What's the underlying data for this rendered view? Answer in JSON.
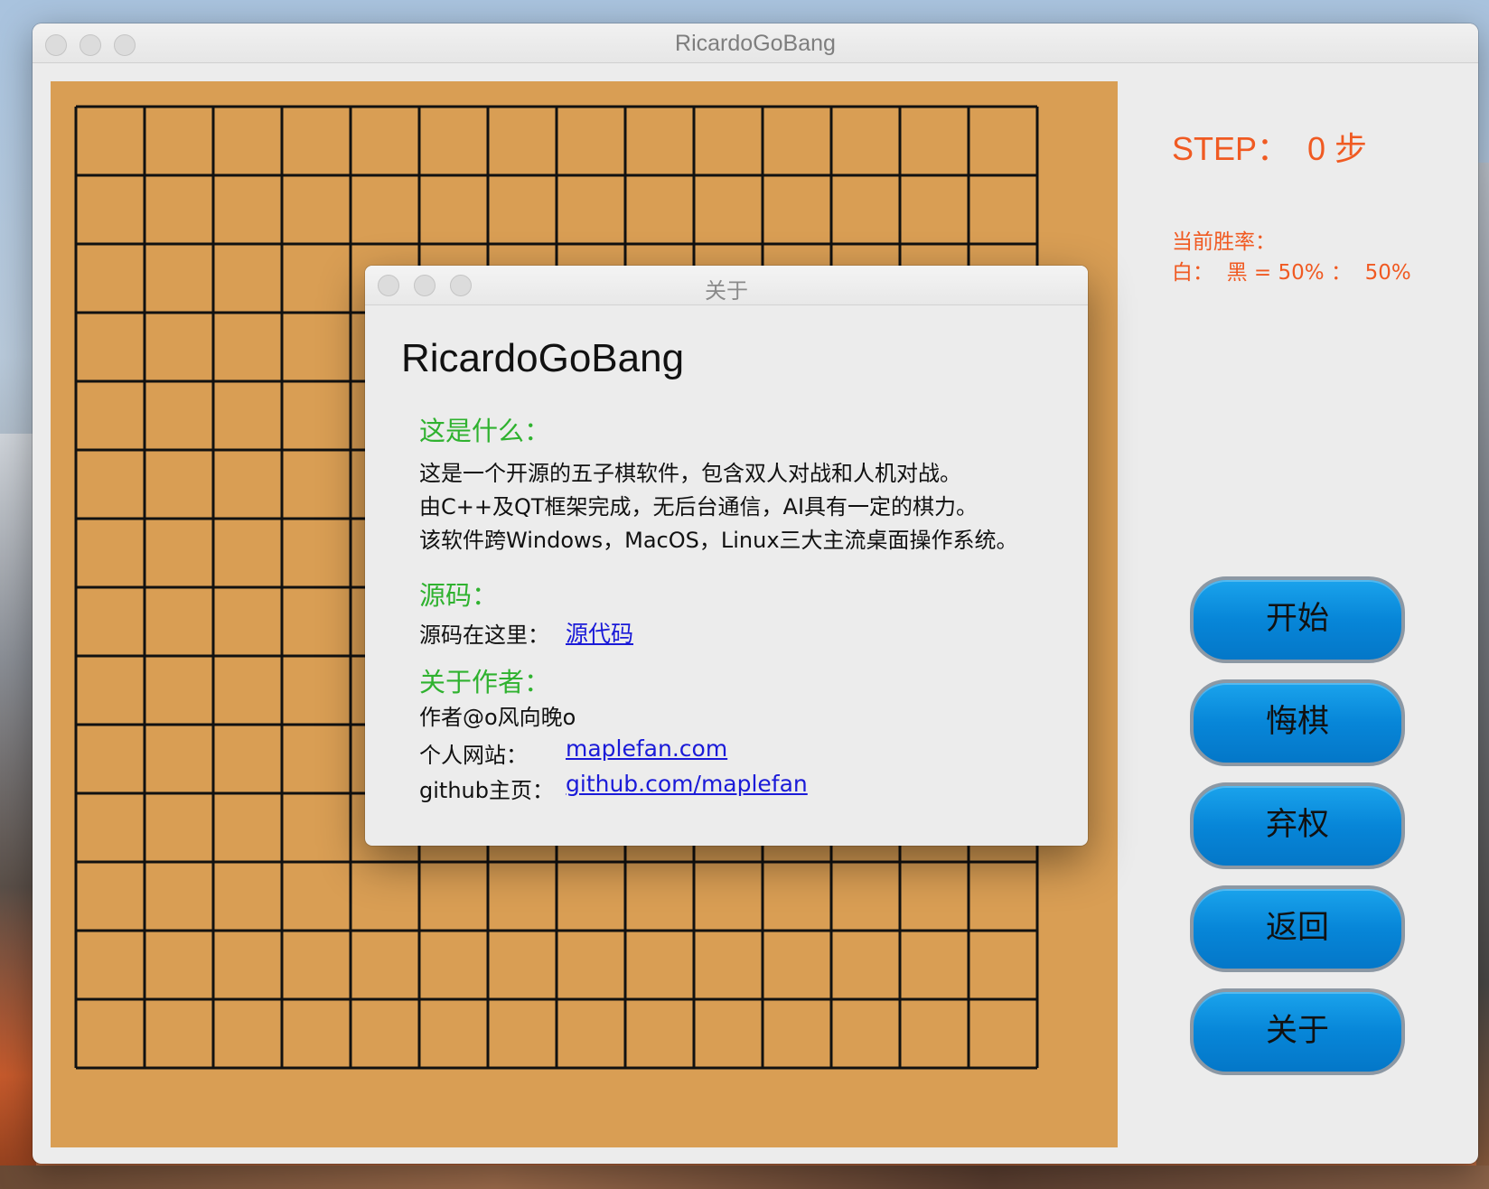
{
  "window": {
    "title": "RicardoGoBang"
  },
  "board": {
    "grid_lines": 15,
    "color": "#d99e54"
  },
  "panel": {
    "step_label": "STEP：  0 步",
    "winrate_title": "当前胜率：",
    "winrate_value": "白：  黑 = 50% ：  50%",
    "accent_color": "#f05a22"
  },
  "buttons": [
    {
      "label": "开始"
    },
    {
      "label": "悔棋"
    },
    {
      "label": "弃权"
    },
    {
      "label": "返回"
    },
    {
      "label": "关于"
    }
  ],
  "about": {
    "title": "关于",
    "app_name": "RicardoGoBang",
    "what_heading": "这是什么：",
    "what_lines": [
      "这是一个开源的五子棋软件，包含双人对战和人机对战。",
      "由C++及QT框架完成，无后台通信，AI具有一定的棋力。",
      "该软件跨Windows，MacOS，Linux三大主流桌面操作系统。"
    ],
    "source_heading": "源码：",
    "source_label": "源码在这里：",
    "source_link": "源代码",
    "author_heading": "关于作者：",
    "author_name": "作者@o风向晚o",
    "website_label": "个人网站：",
    "website_link": "maplefan.com",
    "github_label": "github主页：",
    "github_link": "github.com/maplefan"
  }
}
